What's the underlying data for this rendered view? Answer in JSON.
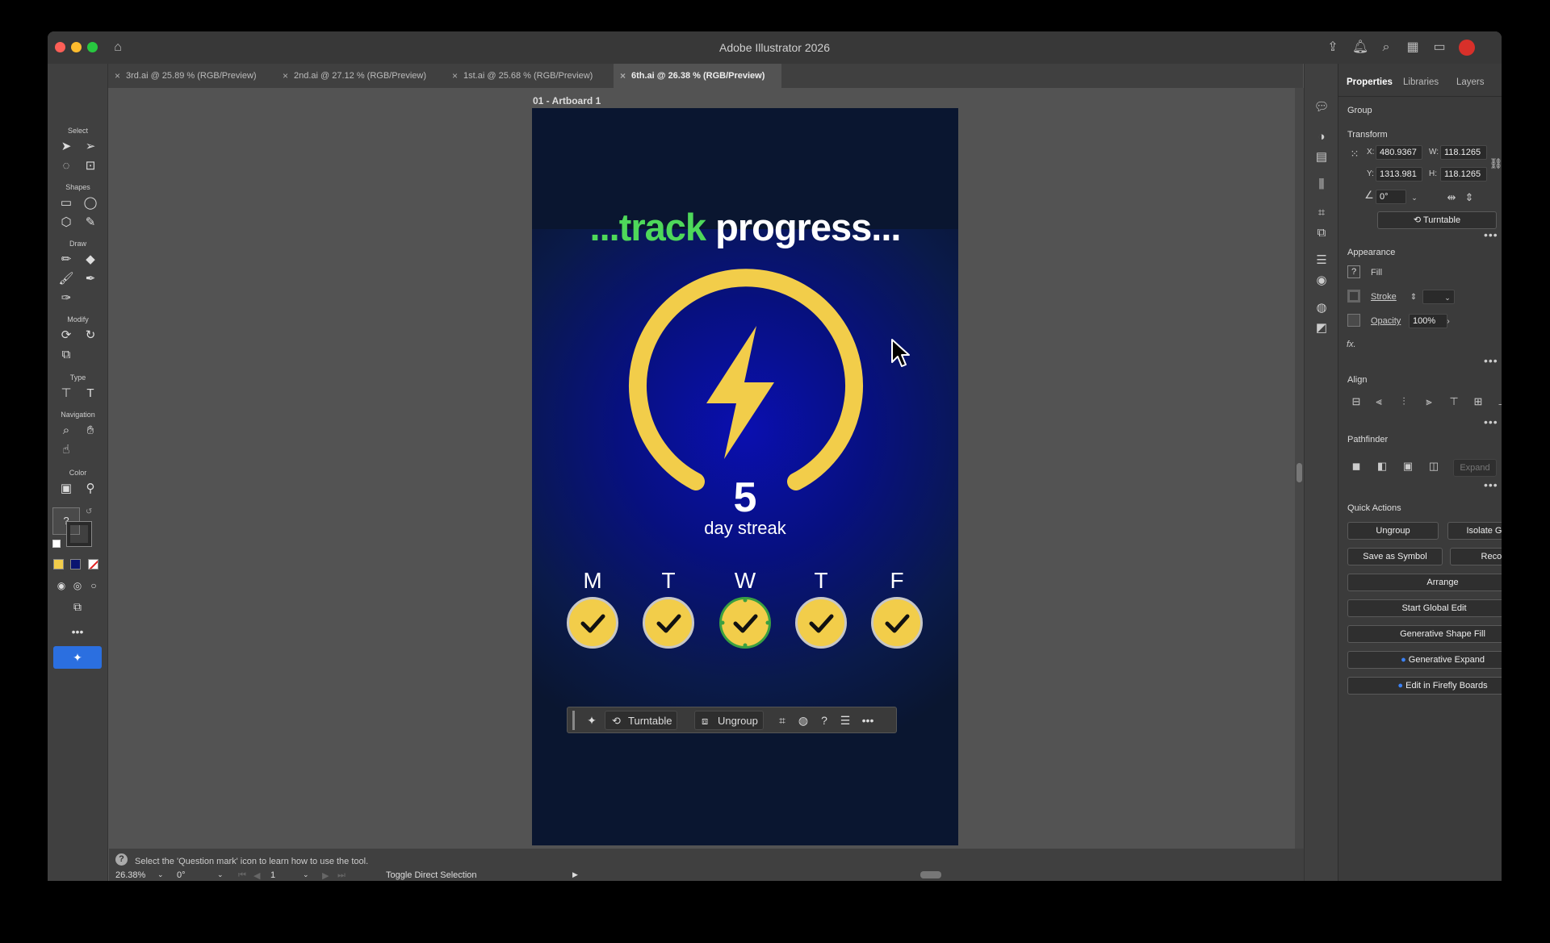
{
  "window": {
    "title": "Adobe Illustrator 2026"
  },
  "tabs": [
    {
      "label": "3rd.ai @ 25.89 % (RGB/Preview)"
    },
    {
      "label": "2nd.ai @ 27.12 % (RGB/Preview)"
    },
    {
      "label": "1st.ai @ 25.68 % (RGB/Preview)"
    },
    {
      "label": "6th.ai @ 26.38 % (RGB/Preview)"
    }
  ],
  "toolbar": {
    "sections": {
      "select": "Select",
      "shapes": "Shapes",
      "draw": "Draw",
      "modify": "Modify",
      "type": "Type",
      "navigation": "Navigation",
      "color": "Color"
    },
    "fill_swatch_glyph": "?"
  },
  "artboard": {
    "label": "01 - Artboard 1",
    "headline_green": "...track",
    "headline_white": "progress...",
    "streak_number": "5",
    "streak_label": "day streak",
    "days": [
      "M",
      "T",
      "W",
      "T",
      "F"
    ],
    "accent_yellow": "#f2cd4a",
    "accent_green": "#4ed85a"
  },
  "context_bar": {
    "turntable": "Turntable",
    "ungroup": "Ungroup",
    "help": "?"
  },
  "status": {
    "hint": "Select the 'Question mark' icon to learn how to use the tool.",
    "zoom": "26.38%",
    "rotation": "0°",
    "artboard_num": "1",
    "tool": "Toggle Direct Selection"
  },
  "panel": {
    "tabs": {
      "properties": "Properties",
      "libraries": "Libraries",
      "layers": "Layers"
    },
    "object_type": "Group",
    "transform": {
      "title": "Transform",
      "x_label": "X:",
      "x": "480.9367",
      "y_label": "Y:",
      "y": "1313.981",
      "w_label": "W:",
      "w": "118.1265",
      "h_label": "H:",
      "h": "118.1265",
      "angle": "0°",
      "turntable": "Turntable"
    },
    "appearance": {
      "title": "Appearance",
      "fill_glyph": "?",
      "fill": "Fill",
      "stroke": "Stroke",
      "opacity": "Opacity",
      "opacity_value": "100%",
      "fx": "fx."
    },
    "align": {
      "title": "Align"
    },
    "pathfinder": {
      "title": "Pathfinder",
      "expand": "Expand"
    },
    "quick_actions": {
      "title": "Quick Actions",
      "ungroup": "Ungroup",
      "isolate_group": "Isolate Group",
      "save_as_symbol": "Save as Symbol",
      "recolor": "Recolor",
      "arrange": "Arrange",
      "start_global_edit": "Start Global Edit",
      "generative_shape_fill": "Generative Shape Fill",
      "generative_expand": "Generative Expand",
      "edit_in_firefly_boards": "Edit in Firefly Boards"
    }
  }
}
